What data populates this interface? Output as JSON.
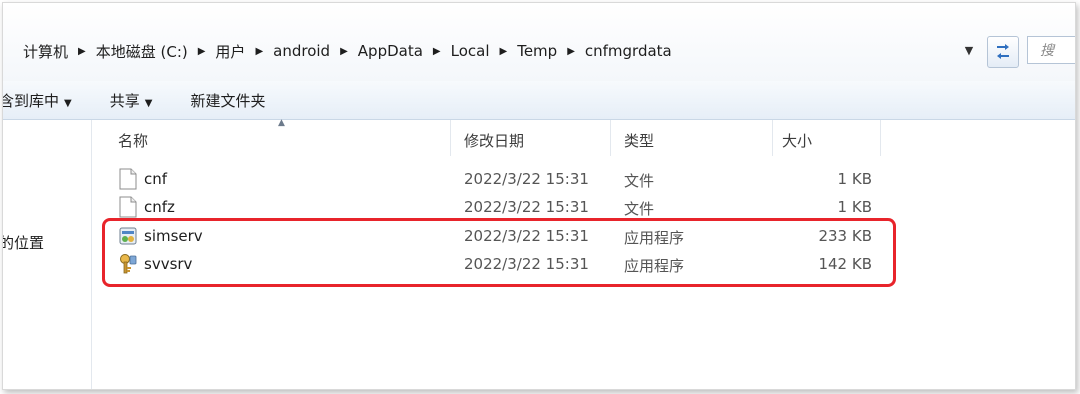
{
  "breadcrumb": [
    {
      "label": "计算机"
    },
    {
      "label": "本地磁盘 (C:)"
    },
    {
      "label": "用户"
    },
    {
      "label": "android"
    },
    {
      "label": "AppData"
    },
    {
      "label": "Local"
    },
    {
      "label": "Temp"
    },
    {
      "label": "cnfmgrdata"
    }
  ],
  "search": {
    "placeholder": "搜"
  },
  "toolbar": {
    "include_label": "含到库中",
    "share_label": "共享",
    "new_folder_label": "新建文件夹"
  },
  "navpane": {
    "item_label": "的位置"
  },
  "columns": {
    "name": "名称",
    "date": "修改日期",
    "type": "类型",
    "size": "大小"
  },
  "files": [
    {
      "name": "cnf",
      "date": "2022/3/22 15:31",
      "type": "文件",
      "size": "1 KB",
      "icon": "blank-file-icon"
    },
    {
      "name": "cnfz",
      "date": "2022/3/22 15:31",
      "type": "文件",
      "size": "1 KB",
      "icon": "blank-file-icon"
    },
    {
      "name": "simserv",
      "date": "2022/3/22 15:31",
      "type": "应用程序",
      "size": "233 KB",
      "icon": "application-icon"
    },
    {
      "name": "svvsrv",
      "date": "2022/3/22 15:31",
      "type": "应用程序",
      "size": "142 KB",
      "icon": "application-key-icon"
    }
  ],
  "colors": {
    "highlight": "#e8242b",
    "toolbar_top": "#f7fafd",
    "toolbar_bottom": "#e6eef7"
  }
}
